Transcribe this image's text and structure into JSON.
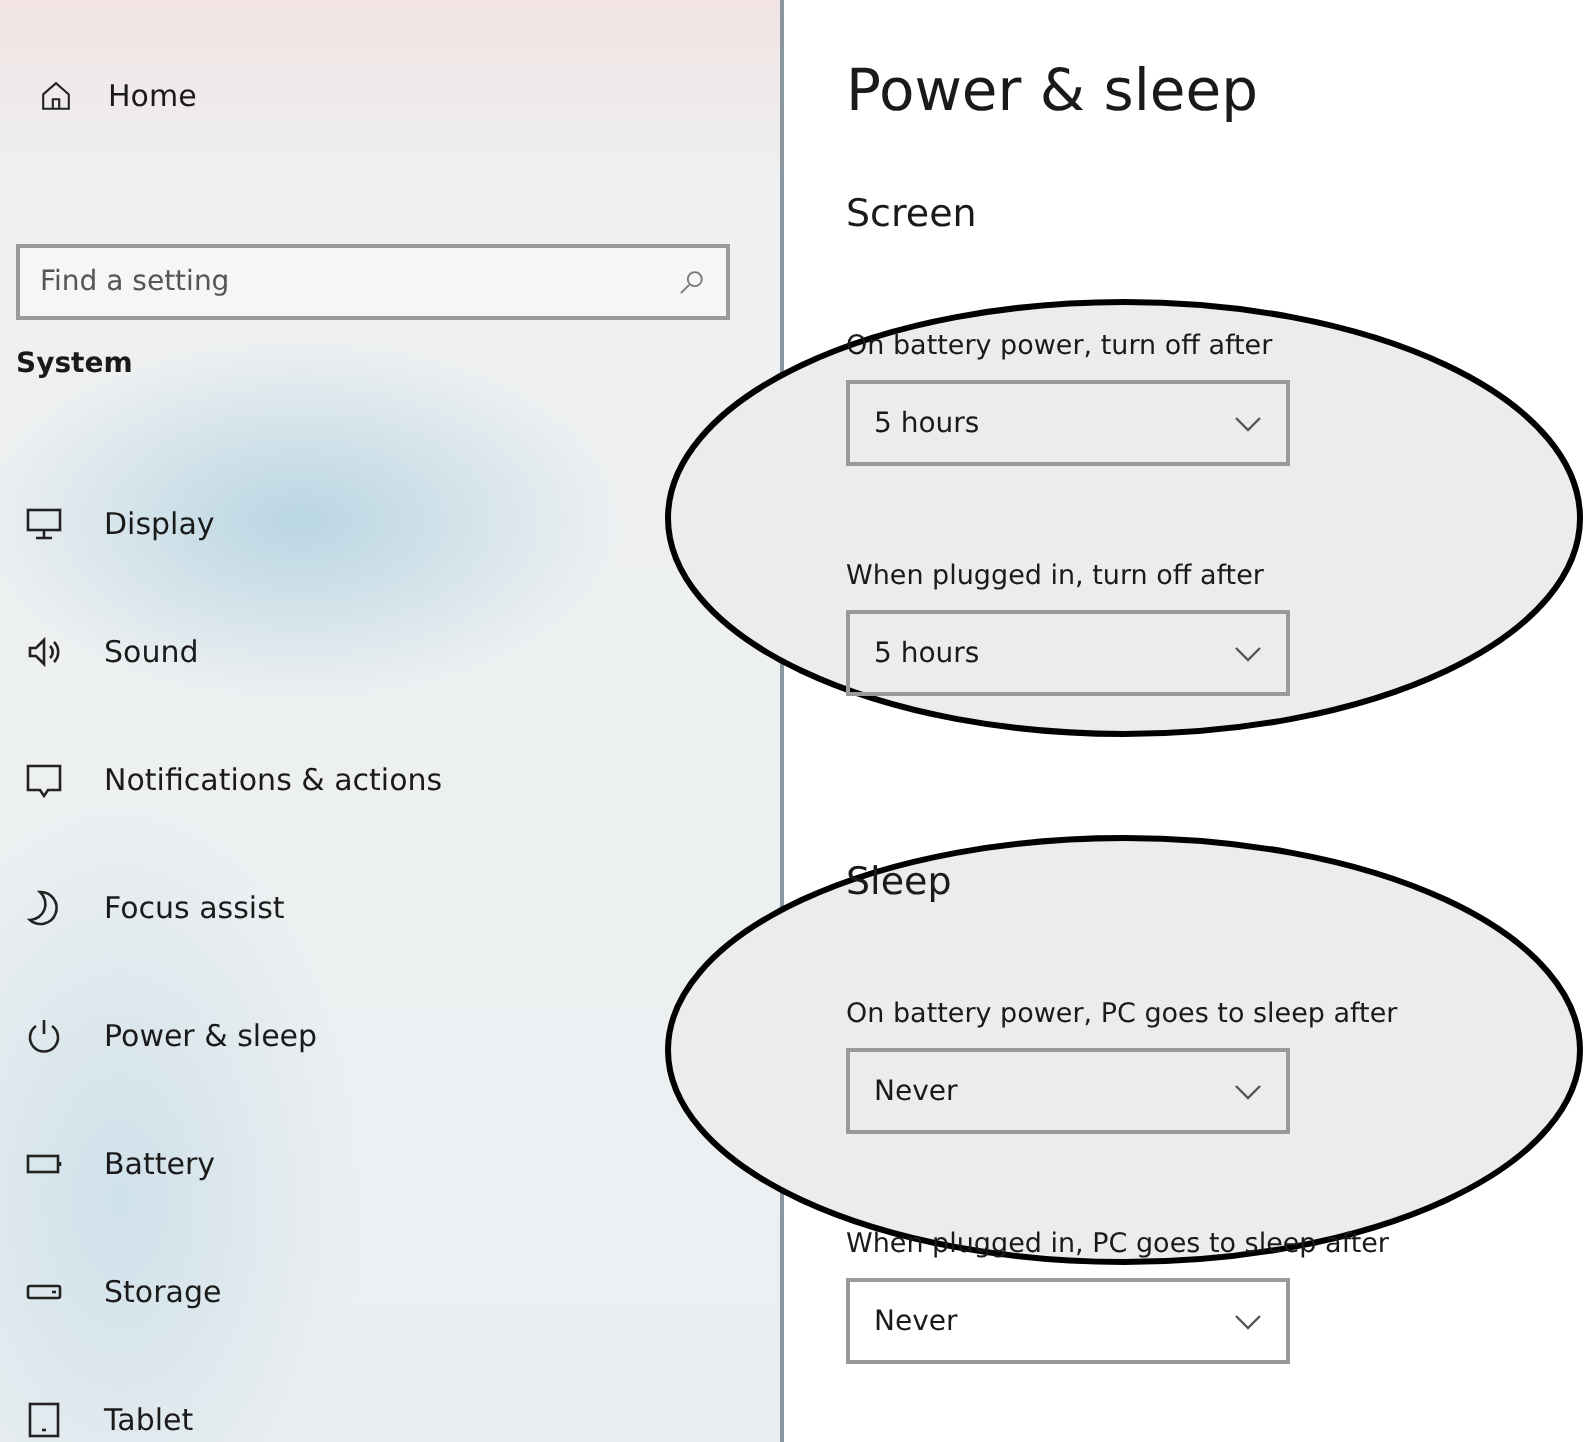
{
  "sidebar": {
    "home": "Home",
    "search": {
      "placeholder": "Find a setting"
    },
    "section": "System",
    "items": [
      {
        "kind": "display",
        "label": "Display"
      },
      {
        "kind": "sound",
        "label": "Sound"
      },
      {
        "kind": "notifications",
        "label": "Notifications & actions"
      },
      {
        "kind": "focus",
        "label": "Focus assist"
      },
      {
        "kind": "power",
        "label": "Power & sleep"
      },
      {
        "kind": "battery",
        "label": "Battery"
      },
      {
        "kind": "storage",
        "label": "Storage"
      },
      {
        "kind": "tablet",
        "label": "Tablet"
      }
    ]
  },
  "main": {
    "title": "Power & sleep",
    "sections": [
      {
        "heading": "Screen",
        "settings": [
          {
            "label": "On battery power, turn off after",
            "value": "5 hours"
          },
          {
            "label": "When plugged in, turn off after",
            "value": "5 hours"
          }
        ]
      },
      {
        "heading": "Sleep",
        "settings": [
          {
            "label": "On battery power, PC goes to sleep after",
            "value": "Never"
          },
          {
            "label": "When plugged in, PC goes to sleep after",
            "value": "Never"
          }
        ]
      }
    ]
  }
}
